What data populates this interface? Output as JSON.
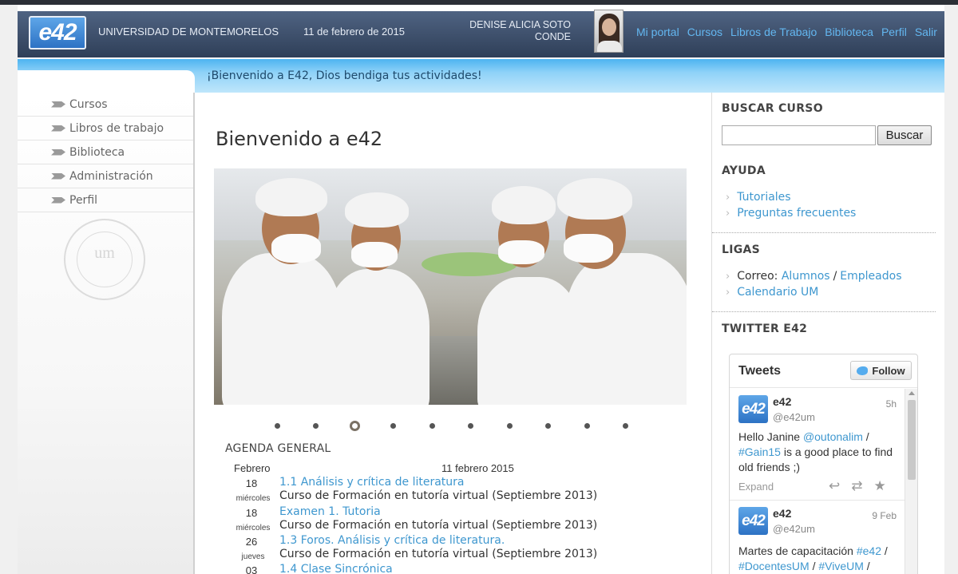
{
  "header": {
    "logo_text": "e42",
    "university": "UNIVERSIDAD DE MONTEMORELOS",
    "date": "11 de febrero de 2015",
    "user_name": "DENISE ALICIA SOTO CONDE",
    "nav": [
      "Mi portal",
      "Cursos",
      "Libros de Trabajo",
      "Biblioteca",
      "Perfil",
      "Salir"
    ]
  },
  "welcome_banner": "¡Bienvenido a E42, Dios bendiga tus actividades!",
  "sidebar": {
    "items": [
      {
        "label": "Cursos"
      },
      {
        "label": "Libros de trabajo"
      },
      {
        "label": "Biblioteca"
      },
      {
        "label": "Administración"
      },
      {
        "label": "Perfil"
      }
    ],
    "seal_text": "um"
  },
  "main": {
    "title": "Bienvenido a e42",
    "carousel": {
      "slide_count": 10,
      "active_index": 2
    },
    "agenda": {
      "title": "AGENDA GENERAL",
      "month": "Febrero",
      "date_heading": "11 febrero 2015",
      "events": [
        {
          "day": "18",
          "weekday": "miércoles",
          "title": "1.1 Análisis y crítica de literatura",
          "course": "Curso de Formación en tutoría virtual (Septiembre 2013)"
        },
        {
          "day": "18",
          "weekday": "miércoles",
          "title": "Examen 1. Tutoria",
          "course": "Curso de Formación en tutoría virtual (Septiembre 2013)"
        },
        {
          "day": "26",
          "weekday": "jueves",
          "title": "1.3 Foros. Análisis y crítica de literatura.",
          "course": "Curso de Formación en tutoría virtual (Septiembre 2013)"
        },
        {
          "day": "03",
          "weekday": "",
          "title": "1.4 Clase Sincrónica",
          "course": ""
        }
      ]
    }
  },
  "right": {
    "search": {
      "heading": "BUSCAR CURSO",
      "value": "",
      "placeholder": "",
      "button": "Buscar"
    },
    "help": {
      "heading": "AYUDA",
      "links": [
        "Tutoriales",
        "Preguntas frecuentes"
      ]
    },
    "links": {
      "heading": "LIGAS",
      "mail_label": "Correo:",
      "mail_students": "Alumnos",
      "mail_separator": "/",
      "mail_employees": "Empleados",
      "calendar": "Calendario UM"
    },
    "twitter": {
      "heading": "TWITTER E42",
      "widget_title": "Tweets",
      "follow_label": "Follow",
      "tweets": [
        {
          "name": "e42",
          "handle": "@e42um",
          "time": "5h",
          "text_prefix": "Hello Janine ",
          "mention": "@outonalim",
          "mid": " / ",
          "hashtag": "#Gain15",
          "text_suffix": " is a good place to find old friends ;)",
          "expand": "Expand"
        },
        {
          "name": "e42",
          "handle": "@e42um",
          "time": "9 Feb",
          "text_prefix": "Martes de capacitación ",
          "tag1": "#e42",
          "sep1": " / ",
          "tag2": "#DocentesUM",
          "sep2": " / ",
          "tag3": "#ViveUM",
          "sep3": " /"
        }
      ]
    }
  },
  "colors": {
    "header_bg": "#3d4e69",
    "link": "#3e97cf",
    "nav_link": "#63b7f0",
    "band": "#8fd2f8"
  }
}
